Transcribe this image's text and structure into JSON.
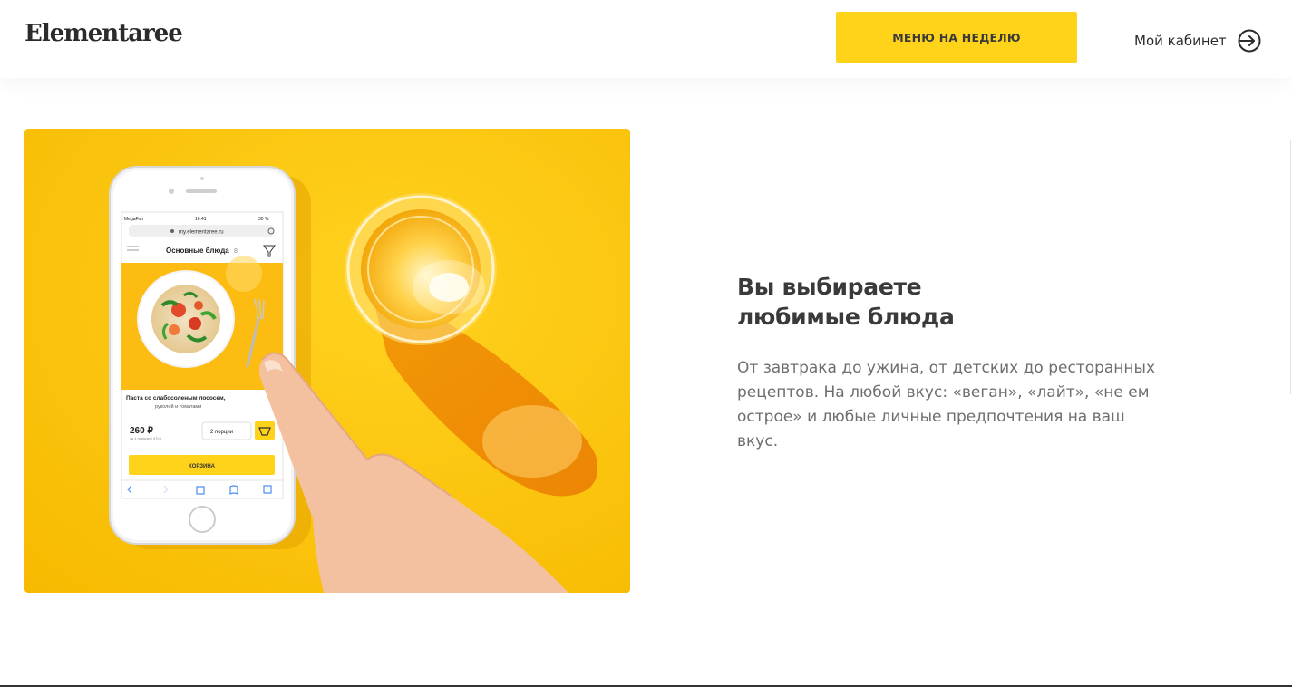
{
  "header": {
    "logo": "Elementaree",
    "menu_button": "МЕНЮ НА НЕДЕЛЮ",
    "cabinet_label": "Мой кабинет",
    "cabinet_icon": "login-arrow-icon"
  },
  "feature": {
    "title_line1": "Вы выбираете",
    "title_line2": "любимые блюда",
    "description": "От завтрака до ужина, от детских до ресторанных рецептов. На любой вкус: «веган», «лайт», «не ем острое» и любые личные предпочтения на ваш вкус."
  },
  "phone": {
    "carrier": "MegaFon",
    "time": "16:41",
    "battery": "30 %",
    "url": "my.elementaree.ru",
    "section_title": "Основные блюда",
    "section_count": "8",
    "dish_name_line1": "Паста со слабосоленым лососем,",
    "dish_name_line2": "руколой и томатами",
    "price": "260 ₽",
    "price_note": "за 1 порцию | 470 г",
    "portions": "2 порции",
    "cart_button": "КОРЗИНА"
  },
  "colors": {
    "accent": "#ffd31a",
    "hero_bg": "#fcc80f",
    "text_dark": "#3a3a3a",
    "text_muted": "#6e6e6e"
  }
}
